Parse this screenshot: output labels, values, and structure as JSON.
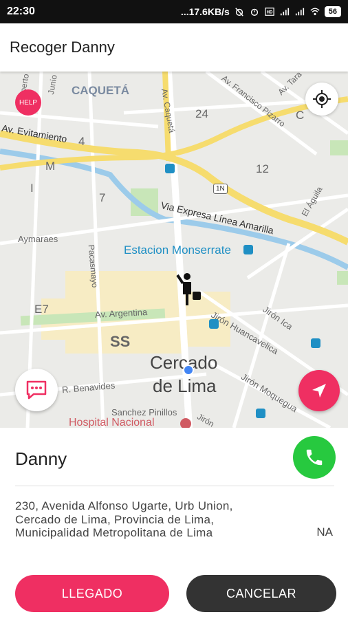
{
  "status_bar": {
    "time": "22:30",
    "network_speed": "...17.6KB/s",
    "battery": "56",
    "icons": [
      "alarm-off-icon",
      "alarm-icon",
      "volte-icon",
      "signal-icon",
      "signal-icon",
      "wifi-icon"
    ]
  },
  "app_bar": {
    "title": "Recoger Danny"
  },
  "map": {
    "help_label": "HELP",
    "labels": {
      "caqueta": "CAQUETÁ",
      "junio": "Junio",
      "av_caqueta": "Av. Caquetá",
      "av_francisco_pizarro": "Av. Francisco Pizarro",
      "av_tarapaca": "Av. Tara",
      "n24": "24",
      "c": "C",
      "av_evitamiento": "Av. Evitamiento",
      "n4": "4",
      "m": "M",
      "n12": "12",
      "i": "I",
      "n7": "7",
      "route_1n": "1N",
      "via_expresa": "Via Expresa Línea Amarilla",
      "el_aguila": "El Águila",
      "aymaraes": "Aymaraes",
      "pacasmayo": "Pacasmayo",
      "estacion_monserrate": "Estacion Monserrate",
      "e7": "E7",
      "av_argentina": "Av. Argentina",
      "jiron_huancavelica": "Jirón Huancavelica",
      "jiron_ica": "Jirón Ica",
      "ss": "SS",
      "cercado_de_lima_1": "Cercado",
      "cercado_de_lima_2": "de Lima",
      "r_benavides": "R. Benavides",
      "jiron_moquegua": "Jirón Moquegua",
      "sanchez_pinillos": "Sanchez Pinillos",
      "hospital_nacional": "Hospital Nacional",
      "jiron": "Jirón",
      "perto": "perto"
    },
    "colors": {
      "highway": "#f6dc6e",
      "water": "#9ccbea",
      "park": "#c8e6b8",
      "district": "#f7ecc4",
      "accent": "#ef2f62",
      "location_dot": "#4285f4"
    }
  },
  "passenger": {
    "name": "Danny",
    "address": "230, Avenida Alfonso Ugarte, Urb Union, Cercado de Lima, Provincia de Lima, Municipalidad Metropolitana de Lima",
    "extra": "NA"
  },
  "actions": {
    "arrived_label": "LLEGADO",
    "cancel_label": "CANCELAR"
  },
  "colors": {
    "accent": "#ef2f62",
    "call": "#27c93f",
    "cancel_bg": "#333333"
  }
}
